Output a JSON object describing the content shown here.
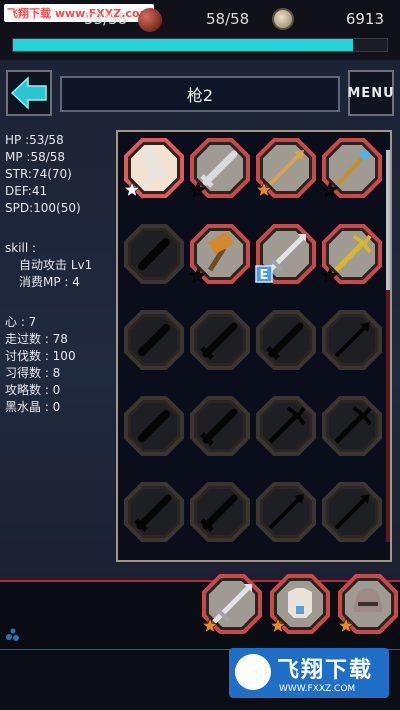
{
  "watermark": "飞翔下载 www.FXXZ.com",
  "topbar": {
    "hp": "53/58",
    "mp": "58/58",
    "money": "6913",
    "hp_fill_fraction": 0.91
  },
  "header": {
    "title": "枪2",
    "menu_label": "MENU"
  },
  "stats": {
    "hp": "HP :53/58",
    "mp": "MP :58/58",
    "str": "STR:74(70)",
    "def": "DEF:41",
    "spd": "SPD:100(50)",
    "skill_title": "skill :",
    "skill_name": "自动攻击 Lv1",
    "skill_cost": "消费MP : 4",
    "heart": "心 : 7",
    "steps": "走过数 : 78",
    "kills": "讨伐数 : 100",
    "learned": "习得数 : 8",
    "strategies": "攻略数 : 0",
    "crystals": "黑水晶 : 0"
  },
  "inventory": {
    "slots": [
      {
        "icon": "white-spear-icon",
        "color": "#e9e5dd",
        "frame": "#e05a5a",
        "star": "white",
        "owned": true,
        "selected": true
      },
      {
        "icon": "sword-icon",
        "color": "#d9dbe0",
        "frame": "#c94848",
        "star": "black",
        "owned": true
      },
      {
        "icon": "spear-icon",
        "color": "#d7a455",
        "frame": "#c94848",
        "star": "orange",
        "owned": true
      },
      {
        "icon": "staff-icon",
        "color": "#c9902a",
        "frame": "#c94848",
        "star": "black",
        "owned": true
      },
      {
        "icon": "dagger-icon",
        "color": "#0a0a0a",
        "frame": "#c94848",
        "owned": false
      },
      {
        "icon": "hammer-icon",
        "color": "#d08a2c",
        "frame": "#c94848",
        "star": "black",
        "owned": true
      },
      {
        "icon": "lance-icon",
        "color": "#e2e2e8",
        "frame": "#c94848",
        "badge": "E",
        "owned": true
      },
      {
        "icon": "trident-icon",
        "color": "#d9b52a",
        "frame": "#c94848",
        "star": "black",
        "owned": true
      },
      {
        "icon": "dagger-icon",
        "owned": false
      },
      {
        "icon": "sword-icon",
        "owned": false
      },
      {
        "icon": "sword-icon",
        "owned": false
      },
      {
        "icon": "spear-icon",
        "owned": false
      },
      {
        "icon": "dagger-icon",
        "owned": false
      },
      {
        "icon": "sword-icon",
        "owned": false
      },
      {
        "icon": "trident-icon",
        "owned": false
      },
      {
        "icon": "trident-icon",
        "owned": false
      },
      {
        "icon": "sword-icon",
        "owned": false
      },
      {
        "icon": "sword-icon",
        "owned": false
      },
      {
        "icon": "spear-icon",
        "owned": false
      },
      {
        "icon": "spear-icon",
        "owned": false
      }
    ]
  },
  "equipped": [
    {
      "icon": "lance-icon",
      "color": "#e2e2e8",
      "star": "orange"
    },
    {
      "icon": "armor-icon",
      "color": "#e8e4da",
      "star": "orange"
    },
    {
      "icon": "helmet-icon",
      "color": "#a08a88",
      "star": "orange"
    }
  ],
  "logo": {
    "name": "飞翔下载",
    "url": "WWW.FXXZ.COM"
  }
}
